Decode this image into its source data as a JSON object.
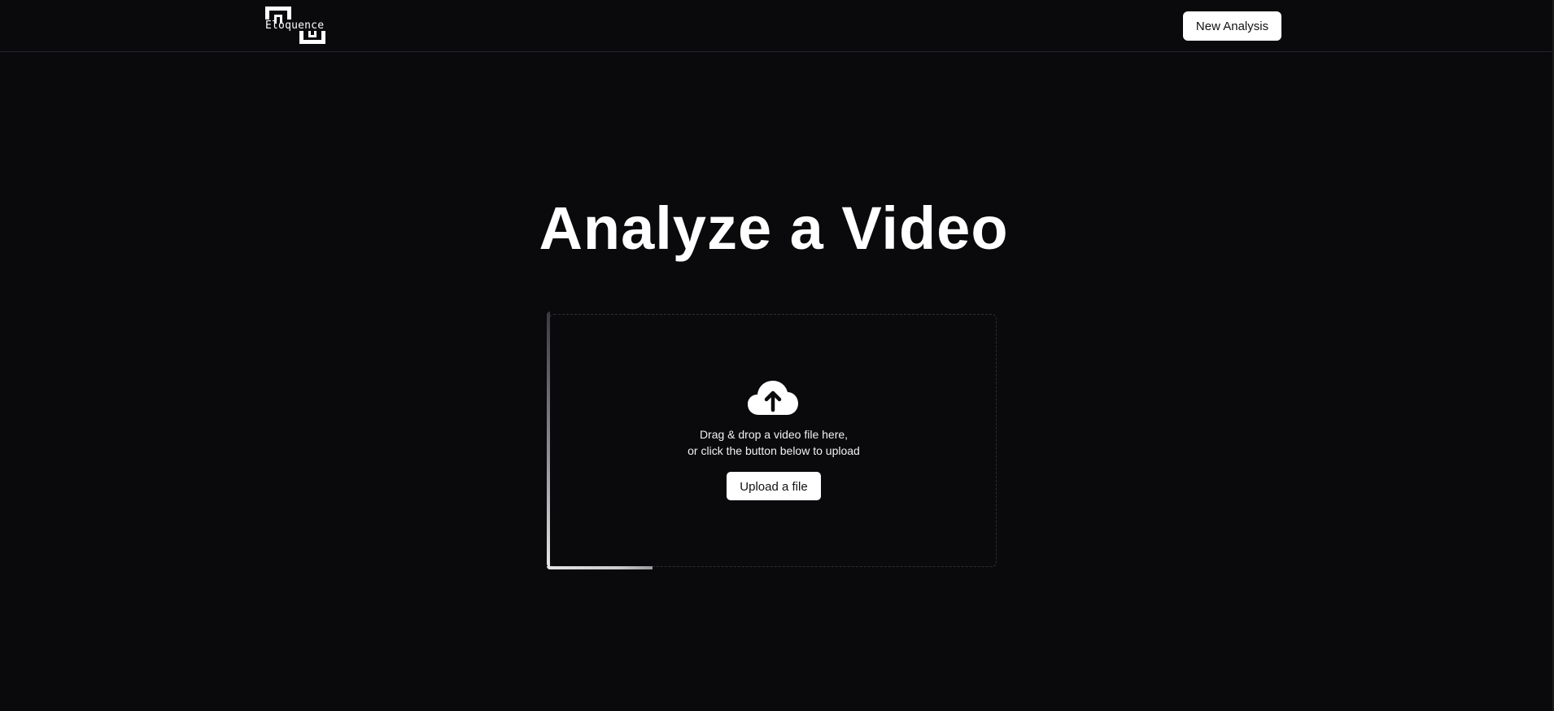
{
  "header": {
    "logo_text": "Eloquence",
    "new_analysis_label": "New Analysis"
  },
  "main": {
    "title": "Analyze a Video",
    "dropzone": {
      "icon": "cloud-upload-icon",
      "line1": "Drag & drop a video file here,",
      "line2": "or click the button below to upload",
      "upload_label": "Upload a file"
    }
  },
  "colors": {
    "background": "#0a0a0c",
    "button_bg": "#ffffff",
    "button_text": "#111114",
    "border": "#2e2e33"
  }
}
